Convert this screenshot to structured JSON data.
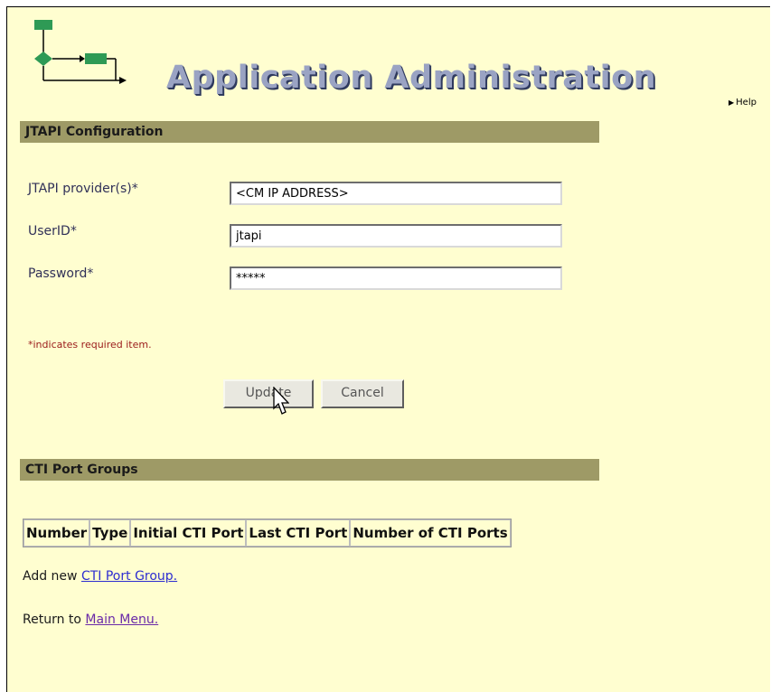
{
  "header": {
    "title": "Application Administration",
    "help_label": "Help"
  },
  "jtapi": {
    "section_title": "JTAPI Configuration",
    "fields": [
      {
        "label": "JTAPI provider(s)*",
        "value": "<CM IP ADDRESS>"
      },
      {
        "label": "UserID*",
        "value": "jtapi"
      },
      {
        "label": "Password*",
        "value": "*****"
      }
    ],
    "required_note": "*indicates required item.",
    "update_label": "Update",
    "cancel_label": "Cancel"
  },
  "cti": {
    "section_title": "CTI Port Groups",
    "columns": [
      "Number",
      "Type",
      "Initial CTI Port",
      "Last CTI Port",
      "Number of CTI Ports"
    ],
    "add_prefix": "Add new",
    "add_link": "CTI Port Group.",
    "return_prefix": "Return to",
    "return_link": "Main Menu."
  },
  "colors": {
    "page_bg": "#fffed0",
    "section_bar": "#9e9a66",
    "logo_green": "#2e9a55",
    "link": "#2d2dd0",
    "visited_link": "#6a2aa8",
    "required_note": "#9a1a1a"
  },
  "icons": {
    "logo": "workflow-diagram-icon",
    "help": "triangle-right-icon",
    "cursor": "mouse-pointer-icon"
  }
}
